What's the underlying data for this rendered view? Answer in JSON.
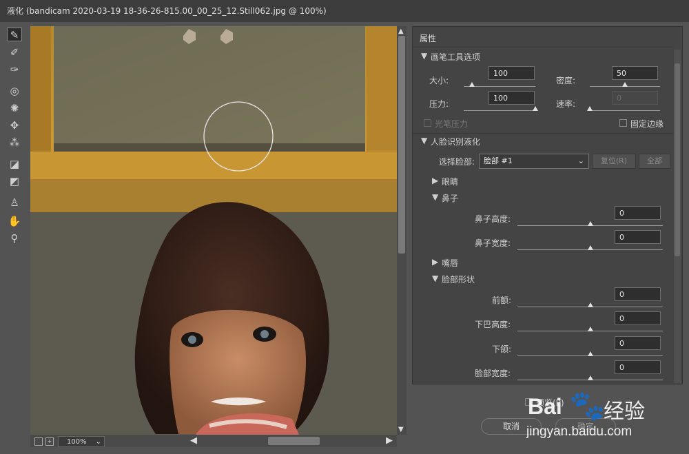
{
  "window": {
    "title": "液化 (bandicam 2020-03-19 18-36-26-815.00_00_25_12.Still062.jpg @ 100%)"
  },
  "toolbar": {
    "tools": [
      "forward-warp",
      "reconstruct",
      "smooth",
      "twirl-clockwise",
      "pucker",
      "bloat",
      "push-left",
      "freeze-mask",
      "thaw-mask",
      "face",
      "hand",
      "zoom"
    ]
  },
  "properties": {
    "title": "属性",
    "brush_section": {
      "title": "画笔工具选项",
      "size_label": "大小:",
      "size_value": "100",
      "size_level": 0.12,
      "density_label": "密度:",
      "density_value": "50",
      "density_level": 0.5,
      "pressure_label": "压力:",
      "pressure_value": "100",
      "pressure_level": 1.0,
      "rate_label": "速率:",
      "rate_value": "0",
      "rate_level": 0.0,
      "stylus_label": "光笔压力",
      "pin_edges_label": "固定边缘"
    },
    "face_section": {
      "title": "人脸识别液化",
      "select_face_label": "选择脸部:",
      "select_face_value": "脸部 #1",
      "reset_label": "复位(R)",
      "all_label": "全部",
      "eyes_label": "眼睛",
      "nose_label": "鼻子",
      "nose_height_label": "鼻子高度:",
      "nose_height_value": "0",
      "nose_width_label": "鼻子宽度:",
      "nose_width_value": "0",
      "mouth_label": "嘴唇",
      "face_shape_label": "脸部形状",
      "forehead_label": "前额:",
      "forehead_value": "0",
      "chin_height_label": "下巴高度:",
      "chin_height_value": "0",
      "jawline_label": "下颌:",
      "jawline_value": "0",
      "face_width_label": "脸部宽度:",
      "face_width_value": "0"
    }
  },
  "preview": {
    "label": "预览(P)"
  },
  "buttons": {
    "cancel": "取消",
    "ok": "确定"
  },
  "status": {
    "zoom": "100%"
  },
  "watermark": {
    "brand": "Bai",
    "brand2": "经验",
    "url": "jingyan.baidu.com"
  },
  "colors": {
    "panel": "#444444",
    "bg": "#535353",
    "wood": "#c8952f"
  }
}
